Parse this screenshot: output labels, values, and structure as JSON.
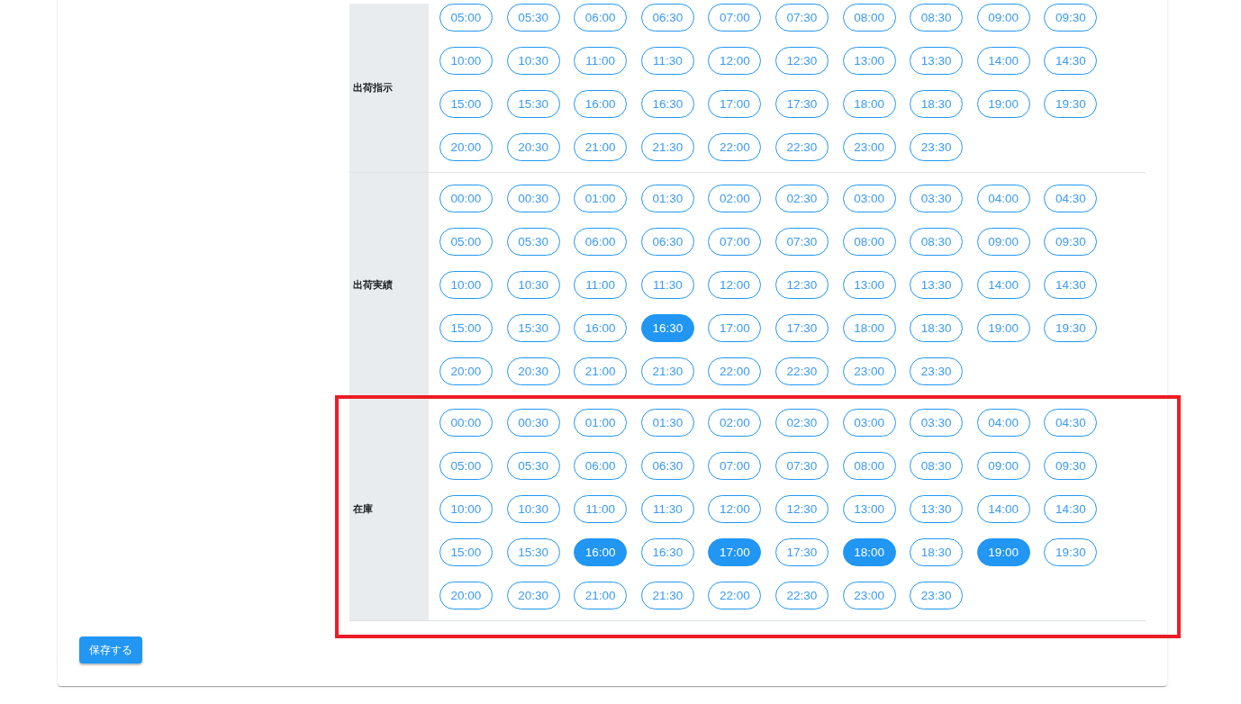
{
  "sections": [
    {
      "label": "出荷指示",
      "highlighted": false,
      "slots": [
        {
          "time": "05:00",
          "selected": false
        },
        {
          "time": "05:30",
          "selected": false
        },
        {
          "time": "06:00",
          "selected": false
        },
        {
          "time": "06:30",
          "selected": false
        },
        {
          "time": "07:00",
          "selected": false
        },
        {
          "time": "07:30",
          "selected": false
        },
        {
          "time": "08:00",
          "selected": false
        },
        {
          "time": "08:30",
          "selected": false
        },
        {
          "time": "09:00",
          "selected": false
        },
        {
          "time": "09:30",
          "selected": false
        },
        {
          "time": "10:00",
          "selected": false
        },
        {
          "time": "10:30",
          "selected": false
        },
        {
          "time": "11:00",
          "selected": false
        },
        {
          "time": "11:30",
          "selected": false
        },
        {
          "time": "12:00",
          "selected": false
        },
        {
          "time": "12:30",
          "selected": false
        },
        {
          "time": "13:00",
          "selected": false
        },
        {
          "time": "13:30",
          "selected": false
        },
        {
          "time": "14:00",
          "selected": false
        },
        {
          "time": "14:30",
          "selected": false
        },
        {
          "time": "15:00",
          "selected": false
        },
        {
          "time": "15:30",
          "selected": false
        },
        {
          "time": "16:00",
          "selected": false
        },
        {
          "time": "16:30",
          "selected": false
        },
        {
          "time": "17:00",
          "selected": false
        },
        {
          "time": "17:30",
          "selected": false
        },
        {
          "time": "18:00",
          "selected": false
        },
        {
          "time": "18:30",
          "selected": false
        },
        {
          "time": "19:00",
          "selected": false
        },
        {
          "time": "19:30",
          "selected": false
        },
        {
          "time": "20:00",
          "selected": false
        },
        {
          "time": "20:30",
          "selected": false
        },
        {
          "time": "21:00",
          "selected": false
        },
        {
          "time": "21:30",
          "selected": false
        },
        {
          "time": "22:00",
          "selected": false
        },
        {
          "time": "22:30",
          "selected": false
        },
        {
          "time": "23:00",
          "selected": false
        },
        {
          "time": "23:30",
          "selected": false
        }
      ]
    },
    {
      "label": "出荷実績",
      "highlighted": false,
      "slots": [
        {
          "time": "00:00",
          "selected": false
        },
        {
          "time": "00:30",
          "selected": false
        },
        {
          "time": "01:00",
          "selected": false
        },
        {
          "time": "01:30",
          "selected": false
        },
        {
          "time": "02:00",
          "selected": false
        },
        {
          "time": "02:30",
          "selected": false
        },
        {
          "time": "03:00",
          "selected": false
        },
        {
          "time": "03:30",
          "selected": false
        },
        {
          "time": "04:00",
          "selected": false
        },
        {
          "time": "04:30",
          "selected": false
        },
        {
          "time": "05:00",
          "selected": false
        },
        {
          "time": "05:30",
          "selected": false
        },
        {
          "time": "06:00",
          "selected": false
        },
        {
          "time": "06:30",
          "selected": false
        },
        {
          "time": "07:00",
          "selected": false
        },
        {
          "time": "07:30",
          "selected": false
        },
        {
          "time": "08:00",
          "selected": false
        },
        {
          "time": "08:30",
          "selected": false
        },
        {
          "time": "09:00",
          "selected": false
        },
        {
          "time": "09:30",
          "selected": false
        },
        {
          "time": "10:00",
          "selected": false
        },
        {
          "time": "10:30",
          "selected": false
        },
        {
          "time": "11:00",
          "selected": false
        },
        {
          "time": "11:30",
          "selected": false
        },
        {
          "time": "12:00",
          "selected": false
        },
        {
          "time": "12:30",
          "selected": false
        },
        {
          "time": "13:00",
          "selected": false
        },
        {
          "time": "13:30",
          "selected": false
        },
        {
          "time": "14:00",
          "selected": false
        },
        {
          "time": "14:30",
          "selected": false
        },
        {
          "time": "15:00",
          "selected": false
        },
        {
          "time": "15:30",
          "selected": false
        },
        {
          "time": "16:00",
          "selected": false
        },
        {
          "time": "16:30",
          "selected": true
        },
        {
          "time": "17:00",
          "selected": false
        },
        {
          "time": "17:30",
          "selected": false
        },
        {
          "time": "18:00",
          "selected": false
        },
        {
          "time": "18:30",
          "selected": false
        },
        {
          "time": "19:00",
          "selected": false
        },
        {
          "time": "19:30",
          "selected": false
        },
        {
          "time": "20:00",
          "selected": false
        },
        {
          "time": "20:30",
          "selected": false
        },
        {
          "time": "21:00",
          "selected": false
        },
        {
          "time": "21:30",
          "selected": false
        },
        {
          "time": "22:00",
          "selected": false
        },
        {
          "time": "22:30",
          "selected": false
        },
        {
          "time": "23:00",
          "selected": false
        },
        {
          "time": "23:30",
          "selected": false
        }
      ]
    },
    {
      "label": "在庫",
      "highlighted": true,
      "slots": [
        {
          "time": "00:00",
          "selected": false
        },
        {
          "time": "00:30",
          "selected": false
        },
        {
          "time": "01:00",
          "selected": false
        },
        {
          "time": "01:30",
          "selected": false
        },
        {
          "time": "02:00",
          "selected": false
        },
        {
          "time": "02:30",
          "selected": false
        },
        {
          "time": "03:00",
          "selected": false
        },
        {
          "time": "03:30",
          "selected": false
        },
        {
          "time": "04:00",
          "selected": false
        },
        {
          "time": "04:30",
          "selected": false
        },
        {
          "time": "05:00",
          "selected": false
        },
        {
          "time": "05:30",
          "selected": false
        },
        {
          "time": "06:00",
          "selected": false
        },
        {
          "time": "06:30",
          "selected": false
        },
        {
          "time": "07:00",
          "selected": false
        },
        {
          "time": "07:30",
          "selected": false
        },
        {
          "time": "08:00",
          "selected": false
        },
        {
          "time": "08:30",
          "selected": false
        },
        {
          "time": "09:00",
          "selected": false
        },
        {
          "time": "09:30",
          "selected": false
        },
        {
          "time": "10:00",
          "selected": false
        },
        {
          "time": "10:30",
          "selected": false
        },
        {
          "time": "11:00",
          "selected": false
        },
        {
          "time": "11:30",
          "selected": false
        },
        {
          "time": "12:00",
          "selected": false
        },
        {
          "time": "12:30",
          "selected": false
        },
        {
          "time": "13:00",
          "selected": false
        },
        {
          "time": "13:30",
          "selected": false
        },
        {
          "time": "14:00",
          "selected": false
        },
        {
          "time": "14:30",
          "selected": false
        },
        {
          "time": "15:00",
          "selected": false
        },
        {
          "time": "15:30",
          "selected": false
        },
        {
          "time": "16:00",
          "selected": true
        },
        {
          "time": "16:30",
          "selected": false
        },
        {
          "time": "17:00",
          "selected": true
        },
        {
          "time": "17:30",
          "selected": false
        },
        {
          "time": "18:00",
          "selected": true
        },
        {
          "time": "18:30",
          "selected": false
        },
        {
          "time": "19:00",
          "selected": true
        },
        {
          "time": "19:30",
          "selected": false
        },
        {
          "time": "20:00",
          "selected": false
        },
        {
          "time": "20:30",
          "selected": false
        },
        {
          "time": "21:00",
          "selected": false
        },
        {
          "time": "21:30",
          "selected": false
        },
        {
          "time": "22:00",
          "selected": false
        },
        {
          "time": "22:30",
          "selected": false
        },
        {
          "time": "23:00",
          "selected": false
        },
        {
          "time": "23:30",
          "selected": false
        }
      ]
    }
  ],
  "save_button": {
    "label": "保存する"
  }
}
